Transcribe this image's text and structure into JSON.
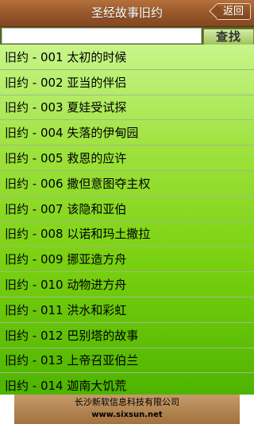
{
  "header": {
    "title": "圣经故事旧约",
    "back_label": "返回"
  },
  "search": {
    "value": "",
    "button_label": "查找"
  },
  "stories": [
    "旧约 - 001 太初的时候",
    "旧约 - 002 亚当的伴侣",
    "旧约 - 003 夏娃受试探",
    "旧约 - 004 失落的伊甸园",
    "旧约 - 005 救恩的应许",
    "旧约 - 006 撒但意图夺主权",
    "旧约 - 007 该隐和亚伯",
    "旧约 - 008 以诺和玛土撒拉",
    "旧约 - 009 挪亚造方舟",
    "旧约 - 010 动物进方舟",
    "旧约 - 011 洪水和彩虹",
    "旧约 - 012 巴别塔的故事",
    "旧约 - 013 上帝召亚伯兰",
    "旧约 - 014 迦南大饥荒"
  ],
  "footer": {
    "company": "长沙新软信息科技有限公司",
    "website": "www.sixsun.net"
  },
  "colors": {
    "header": "#9a5a2c",
    "list_top": "#c8f58a",
    "list_bottom": "#4eb400",
    "footer": "#b48553"
  }
}
